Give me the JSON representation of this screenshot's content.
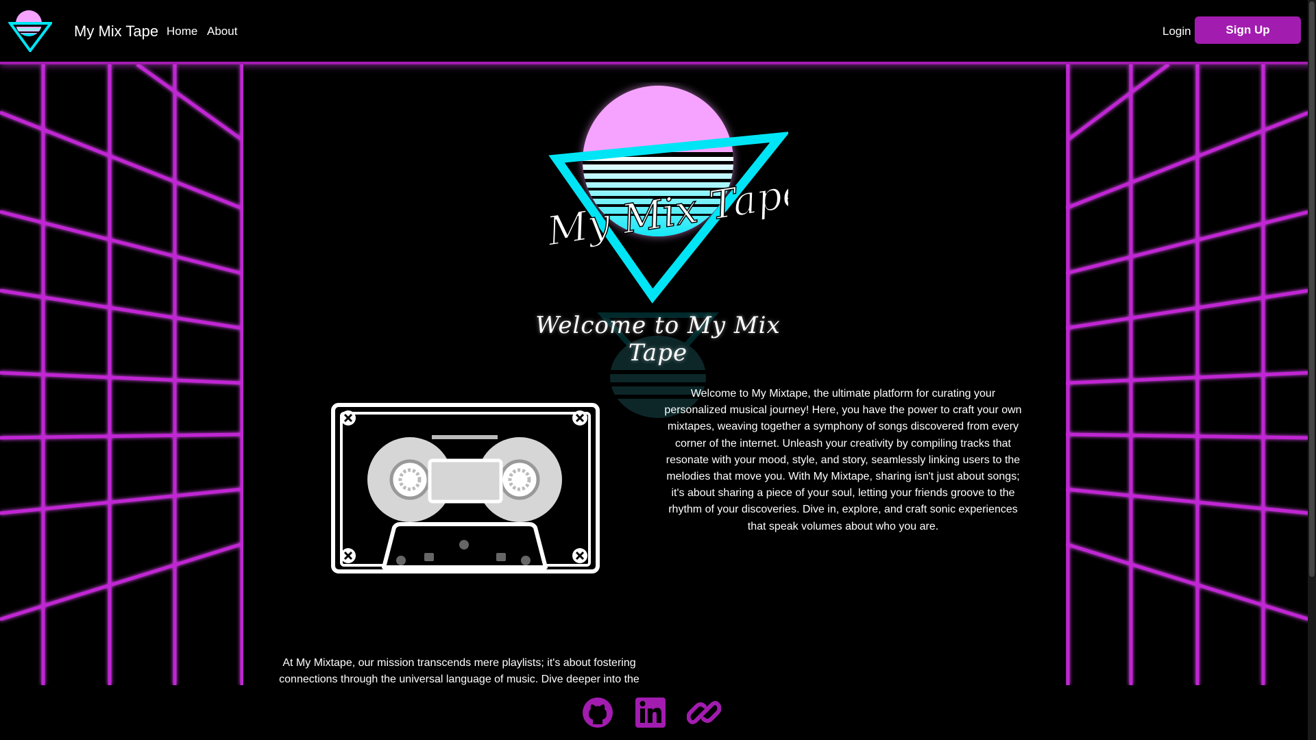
{
  "nav": {
    "brand": "My Mix Tape",
    "home": "Home",
    "about": "About",
    "login": "Login",
    "signup": "Sign Up"
  },
  "hero": {
    "logo_text": "My Mix Tape",
    "welcome_title": "Welcome to My Mix Tape"
  },
  "content": {
    "intro": "Welcome to My Mixtape, the ultimate platform for curating your personalized musical journey! Here, you have the power to craft your own mixtapes, weaving together a symphony of songs discovered from every corner of the internet. Unleash your creativity by compiling tracks that resonate with your mood, style, and story, seamlessly linking users to the melodies that move you. With My Mixtape, sharing isn't just about songs; it's about sharing a piece of your soul, letting your friends groove to the rhythm of your discoveries. Dive in, explore, and craft sonic experiences that speak volumes about who you are.",
    "mission": "At My Mixtape, our mission transcends mere playlists; it's about fostering connections through the universal language of music. Dive deeper into the"
  },
  "footer": {
    "icons": [
      "github-icon",
      "linkedin-icon",
      "link-icon"
    ]
  },
  "colors": {
    "accent": "#a21caf",
    "grid": "#c026d3",
    "cyan": "#00e5f5",
    "sun": "#f5a3ff"
  }
}
